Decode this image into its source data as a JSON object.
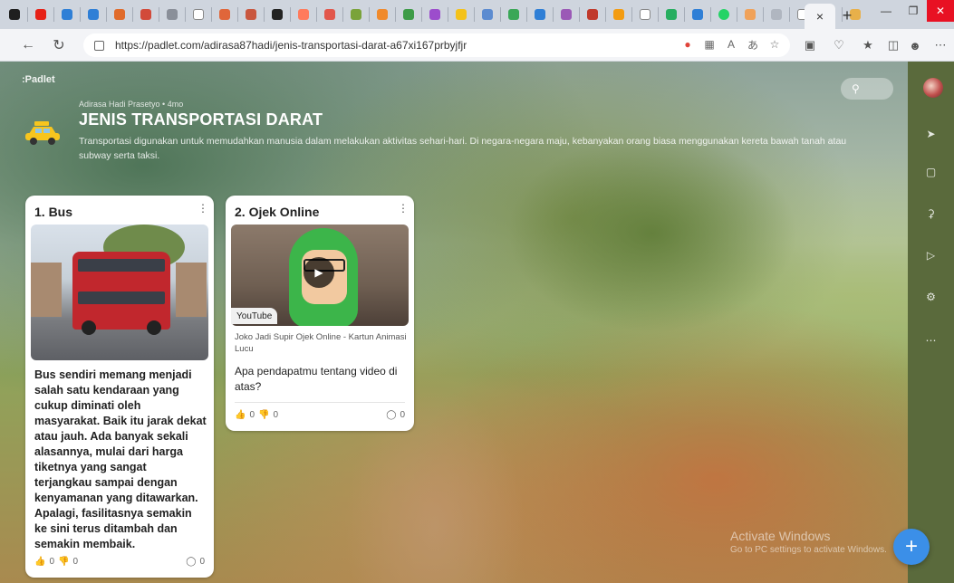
{
  "browser": {
    "tab_close": "×",
    "new_tab": "+",
    "url": "https://padlet.com/adirasa87hadi/jenis-transportasi-darat-a67xi167prbyjfjr",
    "colors": {
      "tab_strip": "#cfd5de",
      "close_btn": "#e81123"
    }
  },
  "padlet": {
    "brand": ":Padlet",
    "owner": "Adirasa Hadi Prasetyo • 4mo",
    "title": "JENIS TRANSPORTASI DARAT",
    "description": "Transportasi digunakan untuk memudahkan manusia dalam melakukan aktivitas sehari-hari. Di negara-negara maju, kebanyakan orang biasa menggunakan kereta bawah tanah atau subway serta taksi."
  },
  "cards": [
    {
      "title": "1. Bus",
      "body": "Bus sendiri memang menjadi salah satu kendaraan yang cukup diminati oleh masyarakat. Baik itu jarak dekat atau jauh. Ada banyak sekali alasannya, mulai dari harga tiketnya yang sangat terjangkau sampai dengan kenyamanan yang ditawarkan. Apalagi, fasilitasnya semakin ke sini terus ditambah dan semakin membaik.",
      "likes": "0",
      "dislikes": "0",
      "comments": "0"
    },
    {
      "title": "2. Ojek Online",
      "video_tag": "YouTube",
      "video_caption": "Joko Jadi Supir Ojek Online - Kartun Animasi Lucu",
      "body": "Apa pendapatmu tentang video di atas?",
      "likes": "0",
      "dislikes": "0",
      "comments": "0"
    }
  ],
  "watermark": {
    "line1": "Activate Windows",
    "line2": "Go to PC settings to activate Windows."
  },
  "accent_color": "#3b8fe8"
}
